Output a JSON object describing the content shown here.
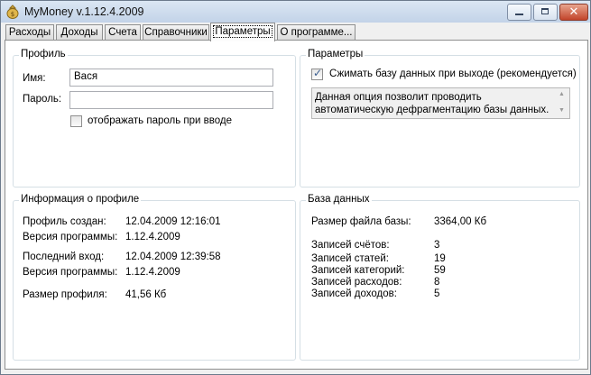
{
  "window": {
    "title": "MyMoney v.1.12.4.2009"
  },
  "tabs": [
    {
      "label": "Расходы"
    },
    {
      "label": "Доходы"
    },
    {
      "label": "Счета"
    },
    {
      "label": "Справочники"
    },
    {
      "label": "Параметры"
    },
    {
      "label": "О программе..."
    }
  ],
  "profile": {
    "title": "Профиль",
    "name_label": "Имя:",
    "name_value": "Вася",
    "password_label": "Пароль:",
    "password_value": "",
    "show_password_label": "отображать пароль при вводе",
    "show_password_checked": false
  },
  "params": {
    "title": "Параметры",
    "compress_label": "Сжимать базу данных при выходе (рекомендуется)",
    "compress_checked": true,
    "description": "Данная опция позволит проводить автоматическую дефрагментацию базы данных."
  },
  "profile_info": {
    "title": "Информация о профиле",
    "rows": [
      {
        "label": "Профиль создан:",
        "value": "12.04.2009 12:16:01"
      },
      {
        "label": "Версия программы:",
        "value": "1.12.4.2009"
      },
      {
        "label": "Последний вход:",
        "value": "12.04.2009 12:39:58"
      },
      {
        "label": "Версия программы:",
        "value": "1.12.4.2009"
      },
      {
        "label": "Размер профиля:",
        "value": "41,56 Кб"
      }
    ]
  },
  "database": {
    "title": "База данных",
    "file_size_label": "Размер файла базы:",
    "file_size_value": "3364,00 Кб",
    "rows": [
      {
        "label": "Записей счётов:",
        "value": "3"
      },
      {
        "label": "Записей статей:",
        "value": "19"
      },
      {
        "label": "Записей категорий:",
        "value": "59"
      },
      {
        "label": "Записей расходов:",
        "value": "8"
      },
      {
        "label": "Записей доходов:",
        "value": "5"
      }
    ]
  },
  "colors": {
    "title_bar": "#c3d3e8",
    "close_button": "#c2442a",
    "checkbox_mark": "#3a5d8f"
  },
  "icons": {
    "app": "money-bag-icon",
    "minimize": "minimize-icon",
    "maximize": "maximize-icon",
    "close": "close-icon",
    "check": "checkmark-icon"
  }
}
